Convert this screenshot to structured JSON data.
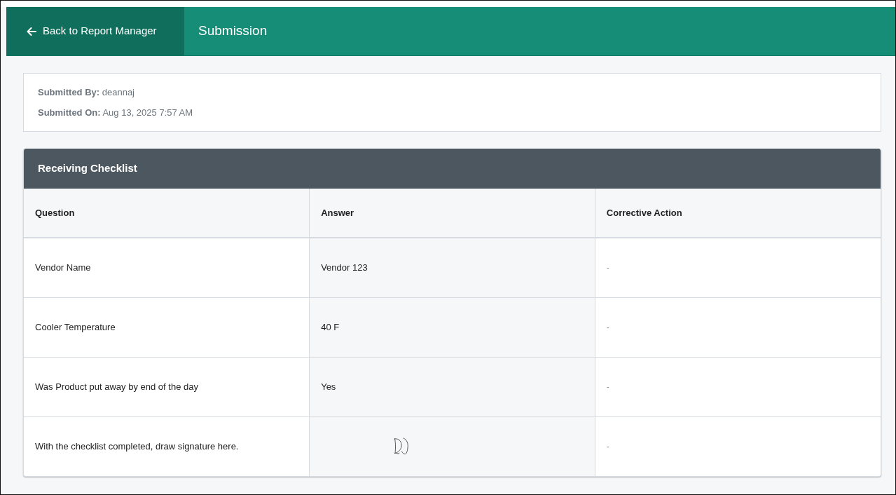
{
  "header": {
    "back_link": "Back to Report Manager",
    "title": "Submission"
  },
  "submission_info": [
    {
      "label": "Submitted By:",
      "value": "deannaj"
    },
    {
      "label": "Submitted On:",
      "value": "Aug 13, 2025 7:57 AM"
    }
  ],
  "checklist": {
    "title": "Receiving Checklist",
    "columns": [
      "Question",
      "Answer",
      "Corrective Action"
    ],
    "rows": [
      {
        "question": "Vendor Name",
        "answer": {
          "kind": "text",
          "text": "Vendor 123"
        },
        "corrective_action": "-"
      },
      {
        "question": "Cooler Temperature",
        "answer": {
          "kind": "text",
          "text": "40 F"
        },
        "corrective_action": "-"
      },
      {
        "question": "Was Product put away by end of the day",
        "answer": {
          "kind": "text",
          "text": "Yes"
        },
        "corrective_action": "-"
      },
      {
        "question": "With the checklist completed, draw signature here.",
        "answer": {
          "kind": "signature"
        },
        "corrective_action": "-"
      }
    ]
  }
}
